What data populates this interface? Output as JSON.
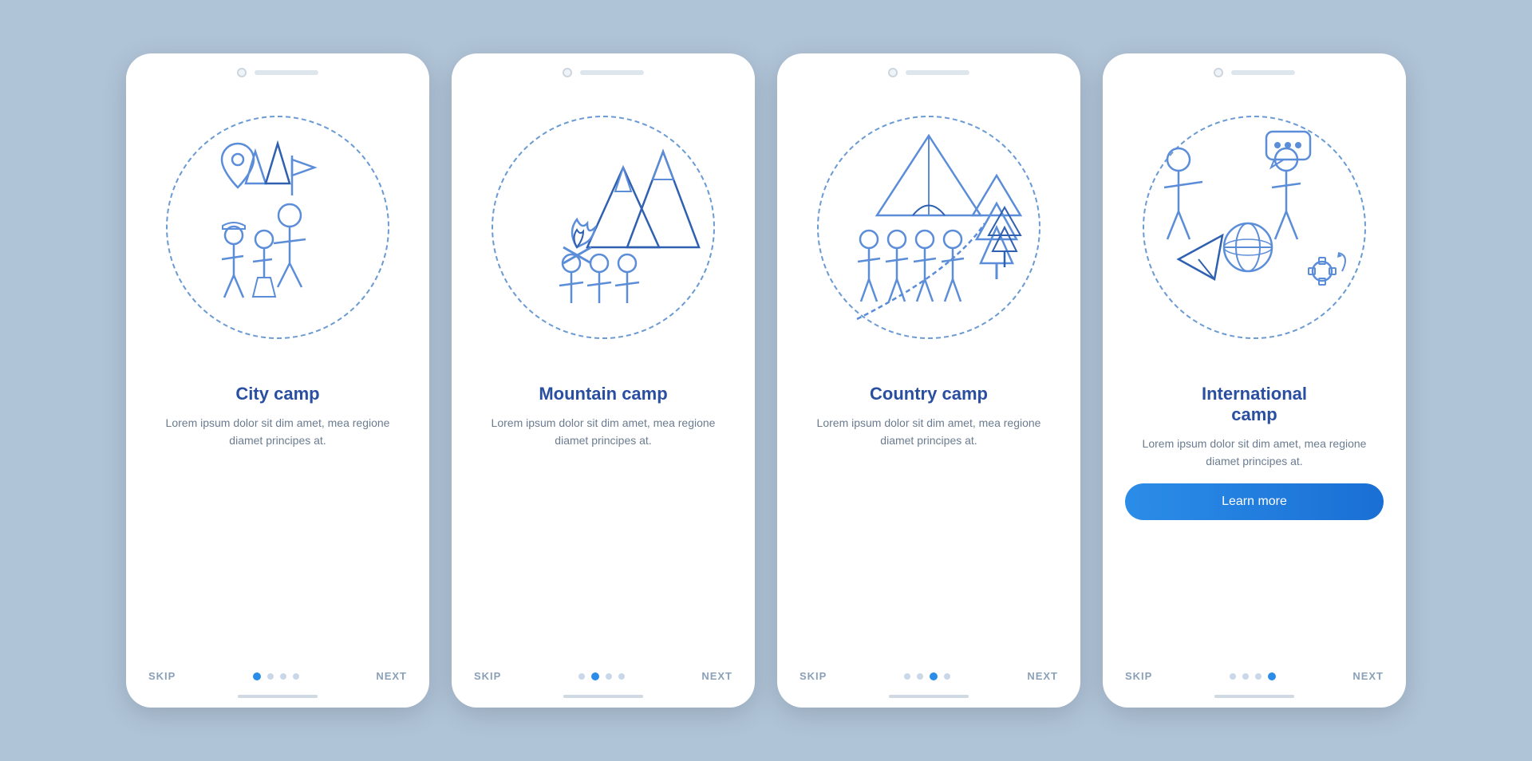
{
  "cards": [
    {
      "id": "city-camp",
      "title": "City camp",
      "description": "Lorem ipsum dolor sit dim amet, mea regione diamet principes at.",
      "activeDot": 0,
      "showLearnMore": false,
      "illustration": "city"
    },
    {
      "id": "mountain-camp",
      "title": "Mountain camp",
      "description": "Lorem ipsum dolor sit dim amet, mea regione diamet principes at.",
      "activeDot": 1,
      "showLearnMore": false,
      "illustration": "mountain"
    },
    {
      "id": "country-camp",
      "title": "Country camp",
      "description": "Lorem ipsum dolor sit dim amet, mea regione diamet principes at.",
      "activeDot": 2,
      "showLearnMore": false,
      "illustration": "country"
    },
    {
      "id": "international-camp",
      "title": "International\ncamp",
      "description": "Lorem ipsum dolor sit dim amet, mea regione diamet principes at.",
      "activeDot": 3,
      "showLearnMore": true,
      "illustration": "international"
    }
  ],
  "navigation": {
    "skip_label": "SKIP",
    "next_label": "NEXT",
    "learn_more_label": "Learn more"
  },
  "colors": {
    "primary": "#2a4fa0",
    "secondary": "#2b8de8",
    "icon_light": "#5b8dd9",
    "icon_dark": "#3060b0",
    "dashed": "#6b9bd2",
    "bg": "#b0c4d8"
  }
}
